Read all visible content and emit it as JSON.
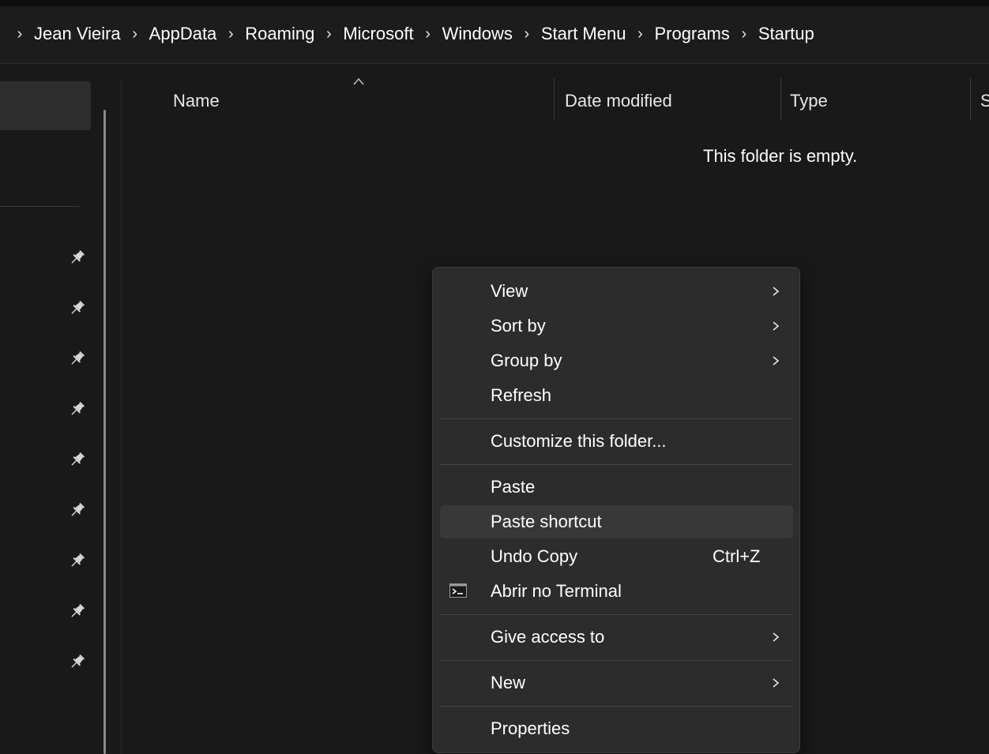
{
  "breadcrumb": {
    "items": [
      "Jean Vieira",
      "AppData",
      "Roaming",
      "Microsoft",
      "Windows",
      "Start Menu",
      "Programs",
      "Startup"
    ]
  },
  "columns": {
    "name": "Name",
    "date_modified": "Date modified",
    "type": "Type",
    "size": "S"
  },
  "content": {
    "empty_message": "This folder is empty."
  },
  "nav_pane": {
    "pinned_count": 9
  },
  "context_menu": {
    "items": [
      {
        "label": "View",
        "submenu": true
      },
      {
        "label": "Sort by",
        "submenu": true
      },
      {
        "label": "Group by",
        "submenu": true
      },
      {
        "label": "Refresh"
      },
      {
        "label": "Customize this folder..."
      },
      {
        "label": "Paste"
      },
      {
        "label": "Paste shortcut",
        "highlighted": true
      },
      {
        "label": "Undo Copy",
        "shortcut": "Ctrl+Z"
      },
      {
        "label": "Abrir no Terminal",
        "icon": "terminal-icon"
      },
      {
        "label": "Give access to",
        "submenu": true
      },
      {
        "label": "New",
        "submenu": true
      },
      {
        "label": "Properties"
      }
    ]
  },
  "colors": {
    "background": "#191919",
    "menu_background": "#2c2c2c",
    "menu_hover": "#383838",
    "text": "#ffffff"
  }
}
